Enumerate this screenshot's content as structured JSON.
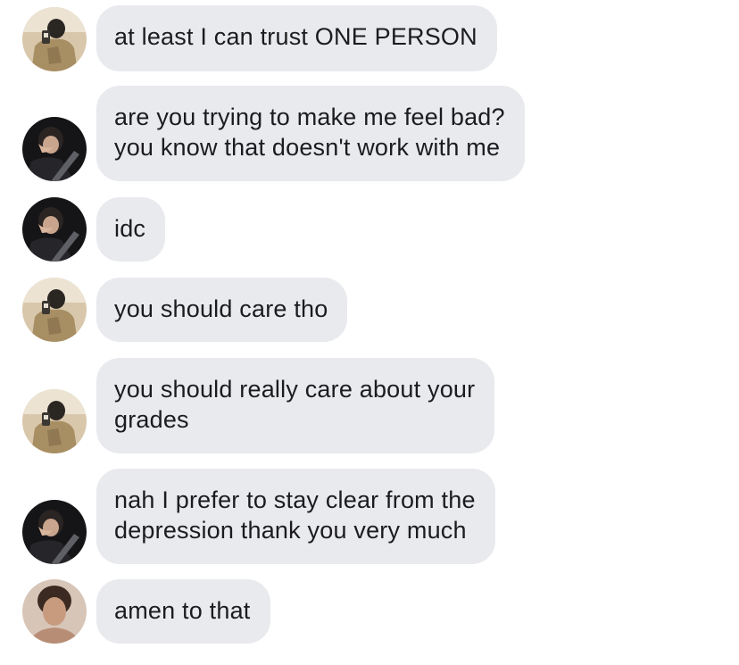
{
  "messages": [
    {
      "text": "at least I can trust ONE PERSON",
      "avatar": "mirror-selfie-avatar"
    },
    {
      "text": "are you trying to make me feel bad?\nyou know that doesn't work with me",
      "avatar": "car-selfie-avatar"
    },
    {
      "text": "idc",
      "avatar": "car-selfie-avatar"
    },
    {
      "text": "you should care tho",
      "avatar": "mirror-selfie-avatar"
    },
    {
      "text": "you should really care about your\ngrades",
      "avatar": "mirror-selfie-avatar"
    },
    {
      "text": "nah I prefer to stay clear from the\ndepression thank you very much",
      "avatar": "car-selfie-avatar"
    },
    {
      "text": "amen to that",
      "avatar": "portrait-avatar"
    }
  ],
  "colors": {
    "bubble": "#e9eaee",
    "text": "#1c1c1e",
    "background": "#ffffff"
  }
}
